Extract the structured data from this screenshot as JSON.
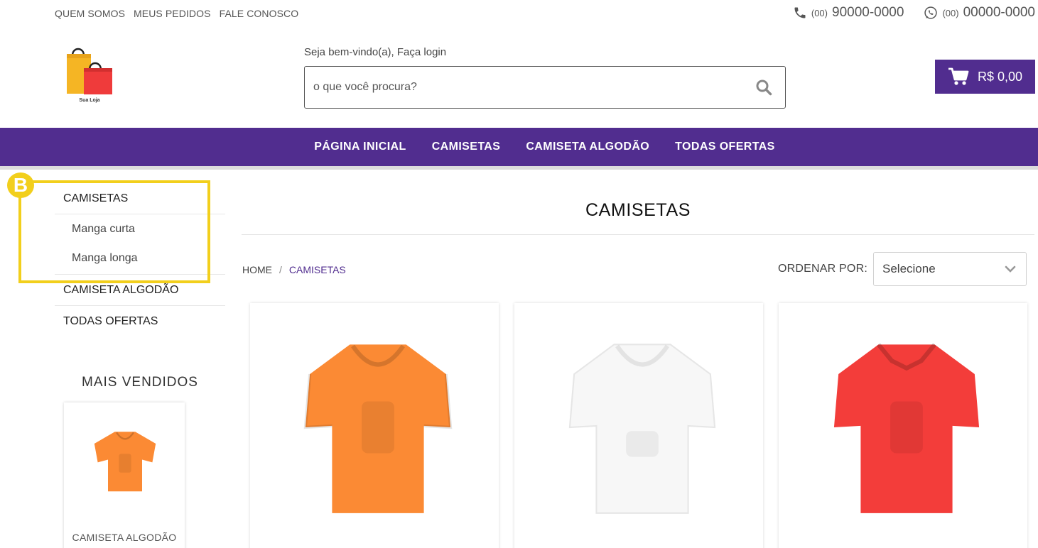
{
  "topbar": {
    "links": [
      "QUEM SOMOS",
      "MEUS PEDIDOS",
      "FALE CONOSCO"
    ],
    "phone": {
      "prefix": "(00)",
      "number": "90000-0000",
      "icon": "phone-icon"
    },
    "whatsapp": {
      "prefix": "(00)",
      "number": "00000-0000",
      "icon": "whatsapp-icon"
    }
  },
  "header": {
    "logo_text": "Sua Loja",
    "welcome": "Seja bem-vindo(a), Faça login",
    "search_placeholder": "o que você procura?",
    "cart_amount": "R$ 0,00"
  },
  "nav": {
    "items": [
      "PÁGINA INICIAL",
      "CAMISETAS",
      "CAMISETA ALGODÃO",
      "TODAS OFERTAS"
    ]
  },
  "sidebar": {
    "badge": "B",
    "categories": [
      {
        "label": "CAMISETAS",
        "children": [
          "Manga curta",
          "Manga longa"
        ]
      },
      {
        "label": "CAMISETA ALGODÃO"
      },
      {
        "label": "TODAS OFERTAS"
      }
    ],
    "best_sellers_title": "MAIS VENDIDOS",
    "best_sellers": [
      {
        "name": "CAMISETA ALGODÃO",
        "color": "#fb8a34"
      }
    ]
  },
  "main": {
    "title": "CAMISETAS",
    "breadcrumb": [
      "HOME",
      "CAMISETAS"
    ],
    "order_label": "ORDENAR POR:",
    "order_selected": "Selecione",
    "products": [
      {
        "color": "#fb8a34"
      },
      {
        "color": "#f7f7f7"
      },
      {
        "color": "#f33d3a"
      }
    ]
  },
  "colors": {
    "accent": "#512d8f",
    "highlight": "#f2cf1c"
  }
}
